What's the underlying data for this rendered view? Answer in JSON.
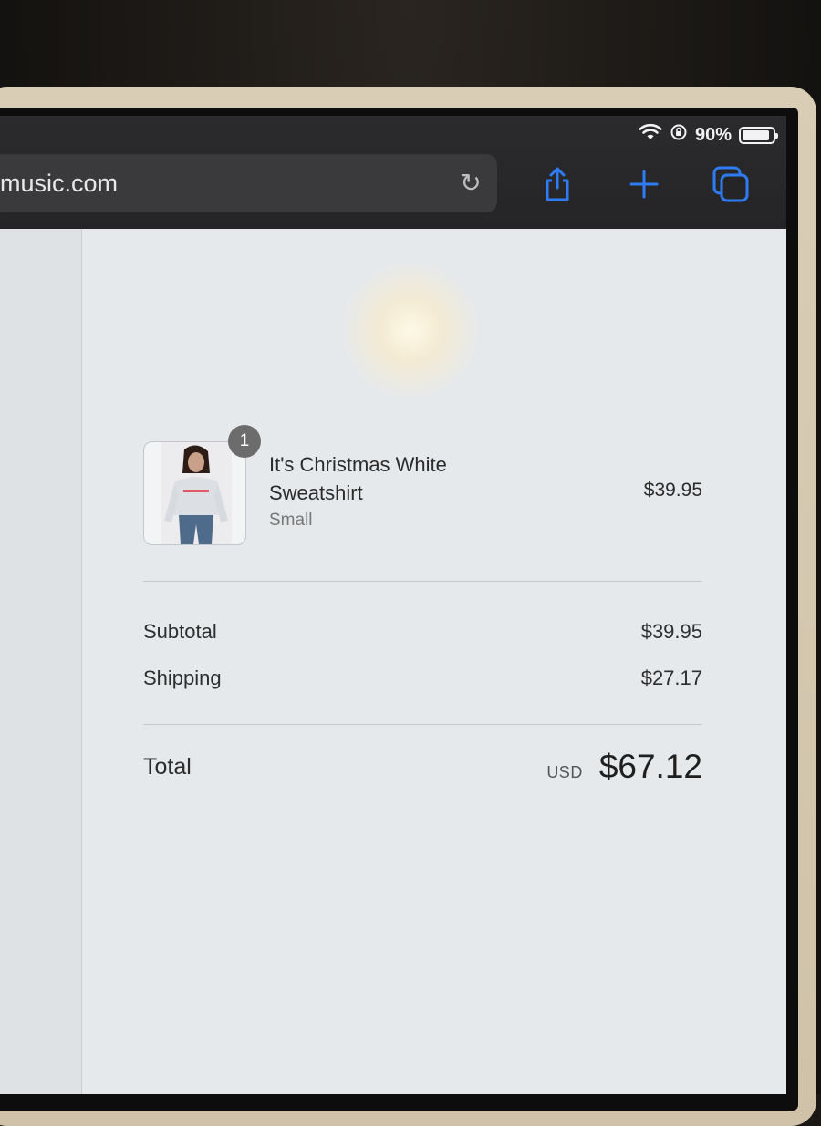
{
  "status_bar": {
    "battery_percent": "90%",
    "battery_level": 0.9,
    "icons": [
      "wifi-icon",
      "orientation-lock-icon",
      "battery-icon"
    ]
  },
  "browser": {
    "url": "music.com",
    "reload_icon": "reload-icon",
    "actions": [
      "share-icon",
      "new-tab-plus-icon",
      "tabs-icon"
    ],
    "accent_color": "#2f7bf5"
  },
  "order": {
    "item": {
      "quantity": "1",
      "name": "It's Christmas White Sweatshirt",
      "variant": "Small",
      "price": "$39.95"
    },
    "subtotal_label": "Subtotal",
    "subtotal_value": "$39.95",
    "shipping_label": "Shipping",
    "shipping_value": "$27.17",
    "total_label": "Total",
    "currency": "USD",
    "total_value": "$67.12"
  }
}
